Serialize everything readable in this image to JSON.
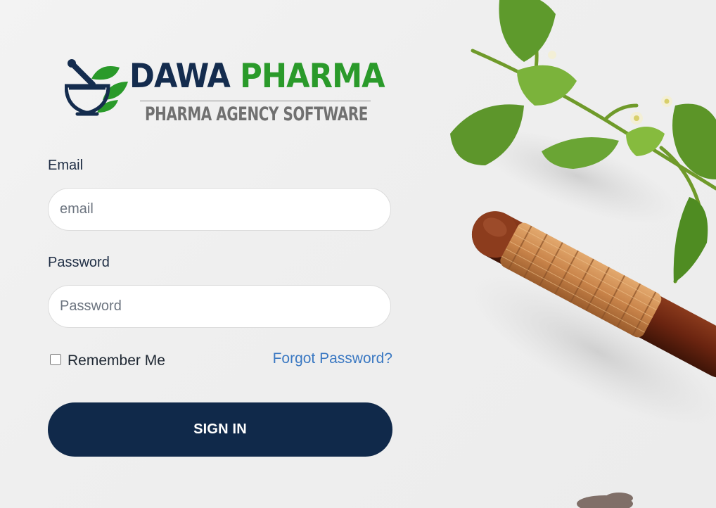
{
  "brand": {
    "name_part1": "DAWA",
    "name_part2": "PHARMA",
    "tagline": "PHARMA AGENCY SOFTWARE",
    "logo_icon": "mortar-pestle-leaf-icon",
    "colors": {
      "navy": "#142c4e",
      "green": "#2a9a2a",
      "tagline_gray": "#707070"
    }
  },
  "form": {
    "email": {
      "label": "Email",
      "placeholder": "email",
      "value": ""
    },
    "password": {
      "label": "Password",
      "placeholder": "Password",
      "value": ""
    },
    "remember_me": {
      "label": "Remember Me",
      "checked": false
    },
    "forgot_password": "Forgot Password?",
    "submit_label": "SIGN IN"
  },
  "theme": {
    "button_bg": "#10294a",
    "link_color": "#3a78c2"
  },
  "background": {
    "illustration": "herb-sprig-and-wooden-pestle-photo"
  }
}
